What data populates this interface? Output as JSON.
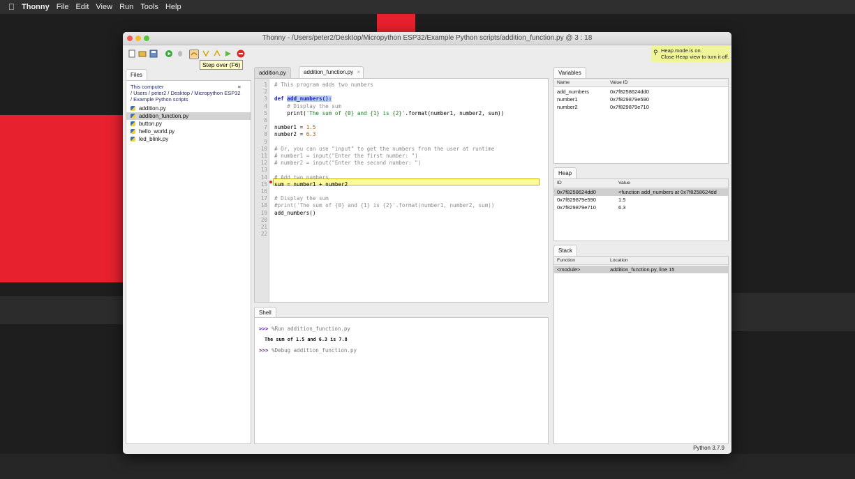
{
  "menubar": {
    "apple": "",
    "app_name": "Thonny",
    "items": [
      "File",
      "Edit",
      "View",
      "Run",
      "Tools",
      "Help"
    ]
  },
  "window": {
    "title": "Thonny  -  /Users/peter2/Desktop/Micropython ESP32/Example Python scripts/addition_function.py  @  3 : 18"
  },
  "toolbar": {
    "tooltip": "Step over (F6)",
    "icons": [
      "new-file-icon",
      "open-file-icon",
      "save-icon",
      "run-icon",
      "debug-icon",
      "step-over-icon",
      "step-into-icon",
      "step-out-icon",
      "resume-icon",
      "stop-icon"
    ]
  },
  "heap_note": {
    "line1": "Heap mode is on.",
    "line2": "Close Heap view to turn it off."
  },
  "files": {
    "tab": "Files",
    "location_label": "This computer",
    "path": "/ Users / peter2 / Desktop / Micropython ESP32 / Example Python scripts",
    "items": [
      "addition.py",
      "addition_function.py",
      "button.py",
      "hello_world.py",
      "led_blink.py"
    ],
    "selected": "addition_function.py"
  },
  "editor": {
    "tabs": [
      "addition.py",
      "addition_function.py"
    ],
    "active_tab": "addition_function.py",
    "line_numbers": [
      "1",
      "2",
      "3",
      "4",
      "5",
      "6",
      "7",
      "8",
      "9",
      "10",
      "11",
      "12",
      "13",
      "14",
      "15",
      "16",
      "17",
      "18",
      "19",
      "20",
      "21",
      "22"
    ],
    "lines": [
      "# This program adds two numbers",
      "",
      "def add_numbers():",
      "    # Display the sum",
      "    print('The sum of {0} and {1} is {2}'.format(number1, number2, sum))",
      "",
      "number1 = 1.5",
      "number2 = 6.3",
      "",
      "# Or, you can use \"input\" to get the numbers from the user at runtime",
      "# number1 = input(\"Enter the first number: \")",
      "# number2 = input(\"Enter the second number: \")",
      "",
      "# Add two numbers",
      "sum = number1 + number2",
      "",
      "# Display the sum",
      "#print('The sum of {0} and {1} is {2}'.format(number1, number2, sum))",
      "add_numbers()",
      "",
      "",
      ""
    ],
    "current_line": "15"
  },
  "shell": {
    "tab": "Shell",
    "prompt": ">>>",
    "cmd1": "%Run addition_function.py",
    "output": "The sum of 1.5 and 6.3 is 7.8",
    "cmd2": "%Debug addition_function.py"
  },
  "variables": {
    "tab": "Variables",
    "headers": [
      "Name",
      "Value ID"
    ],
    "rows": [
      [
        "add_numbers",
        "0x7f8258624dd0"
      ],
      [
        "number1",
        "0x7f829879e590"
      ],
      [
        "number2",
        "0x7f829879e710"
      ]
    ]
  },
  "heap": {
    "tab": "Heap",
    "headers": [
      "ID",
      "Value"
    ],
    "rows": [
      [
        "0x7f8258624dd0",
        "<function add_numbers at 0x7f8258624dd"
      ],
      [
        "0x7f829879e590",
        "1.5"
      ],
      [
        "0x7f829879e710",
        "6.3"
      ]
    ]
  },
  "stack": {
    "tab": "Stack",
    "headers": [
      "Function",
      "Location"
    ],
    "rows": [
      [
        "<module>",
        "addition_function.py, line 15"
      ]
    ]
  },
  "status": {
    "interpreter": "Python 3.7.9"
  },
  "colors": {
    "brand_red": "#e8212e",
    "highlight_line": "#fffa9b",
    "heap_note_bg": "#f1f59a"
  }
}
